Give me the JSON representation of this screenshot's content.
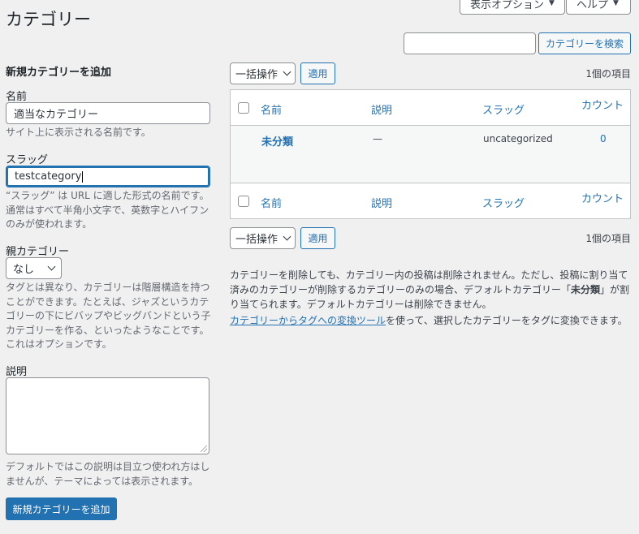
{
  "header": {
    "title": "カテゴリー",
    "screen_options_label": "表示オプション",
    "help_label": "ヘルプ",
    "search_value": "",
    "search_button_label": "カテゴリーを検索"
  },
  "form": {
    "heading": "新規カテゴリーを追加",
    "name_label": "名前",
    "name_value": "適当なカテゴリー",
    "name_help": "サイト上に表示される名前です。",
    "slug_label": "スラッグ",
    "slug_value": "testcategory",
    "slug_help": "“スラッグ” は URL に適した形式の名前です。通常はすべて半角小文字で、英数字とハイフンのみが使われます。",
    "parent_label": "親カテゴリー",
    "parent_selected": "なし",
    "parent_help": "タグとは異なり、カテゴリーは階層構造を持つことができます。たとえば、ジャズというカテゴリーの下にビバップやビッグバンドという子カテゴリーを作る、といったようなことです。これはオプションです。",
    "description_label": "説明",
    "description_value": "",
    "description_help": "デフォルトではこの説明は目立つ使われ方はしませんが、テーマによっては表示されます。",
    "submit_label": "新規カテゴリーを追加"
  },
  "list": {
    "bulk_action_label": "一括操作",
    "apply_label": "適用",
    "item_count": "1個の項目",
    "columns": {
      "name": "名前",
      "description": "説明",
      "slug": "スラッグ",
      "count": "カウント"
    },
    "rows": [
      {
        "name": "未分類",
        "description": "—",
        "slug": "uncategorized",
        "count": "0"
      }
    ]
  },
  "notes": {
    "paragraph1": "カテゴリーを削除しても、カテゴリー内の投稿は削除されません。ただし、投稿に割り当て済みのカテゴリーが削除するカテゴリーのみの場合、デフォルトカテゴリー「",
    "paragraph1_bold": "未分類",
    "paragraph1_end": "」が割り当てられます。デフォルトカテゴリーは削除できません。",
    "link_text": "カテゴリーからタグへの変換ツール",
    "paragraph2_rest": "を使って、選択したカテゴリーをタグに変換できます。"
  }
}
